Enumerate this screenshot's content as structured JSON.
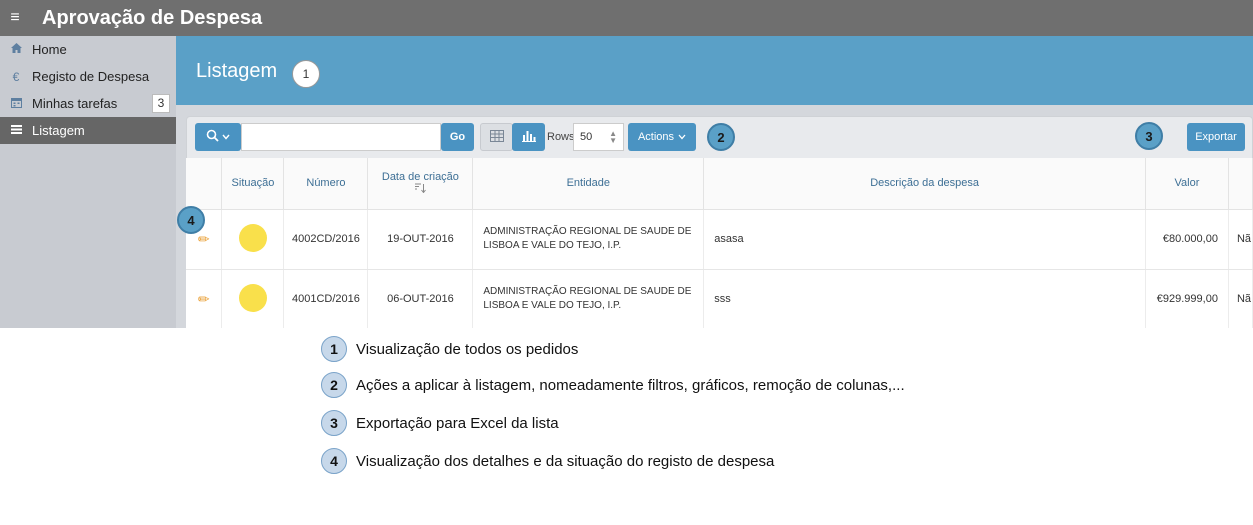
{
  "app": {
    "title": "Aprovação de Despesa",
    "menu_icon": "≡"
  },
  "sidebar": {
    "items": [
      {
        "label": "Home",
        "icon": "home-icon",
        "active": false
      },
      {
        "label": "Registo de Despesa",
        "icon": "euro-icon",
        "active": false
      },
      {
        "label": "Minhas tarefas",
        "icon": "calendar-icon",
        "badge": "3",
        "active": false
      },
      {
        "label": "Listagem",
        "icon": "list-icon",
        "active": true
      }
    ]
  },
  "page": {
    "title": "Listagem",
    "callout": "1"
  },
  "toolbar": {
    "search_placeholder": "",
    "go_label": "Go",
    "rows_label": "Rows",
    "rows_value": "50",
    "actions_label": "Actions",
    "actions_callout": "2",
    "export_label": "Exportar",
    "export_callout": "3"
  },
  "table": {
    "row_callout": "4",
    "columns": [
      "Situação",
      "Número",
      "Data de criação",
      "Entidade",
      "Descrição da despesa",
      "Valor"
    ],
    "rows": [
      {
        "numero": "4002CD/2016",
        "data": "19-OUT-2016",
        "entidade": "ADMINISTRAÇÃO REGIONAL DE SAUDE DE LISBOA E VALE DO TEJO, I.P.",
        "descricao": "asasa",
        "valor": "€80.000,00",
        "extra": "Nã"
      },
      {
        "numero": "4001CD/2016",
        "data": "06-OUT-2016",
        "entidade": "ADMINISTRAÇÃO REGIONAL DE SAUDE DE LISBOA E VALE DO TEJO, I.P.",
        "descricao": "sss",
        "valor": "€929.999,00",
        "extra": "Nã"
      }
    ]
  },
  "legend": [
    {
      "num": "1",
      "text": "Visualização de todos os pedidos"
    },
    {
      "num": "2",
      "text": "Ações a aplicar à listagem, nomeadamente filtros, gráficos, remoção de colunas,..."
    },
    {
      "num": "3",
      "text": "Exportação para Excel da lista"
    },
    {
      "num": "4",
      "text": "Visualização dos detalhes e da situação do registo de despesa"
    }
  ],
  "colors": {
    "accent": "#5aa0c7",
    "button": "#4a93c2",
    "topbar": "#6f6f6f",
    "status_pending": "#f9e04b"
  }
}
